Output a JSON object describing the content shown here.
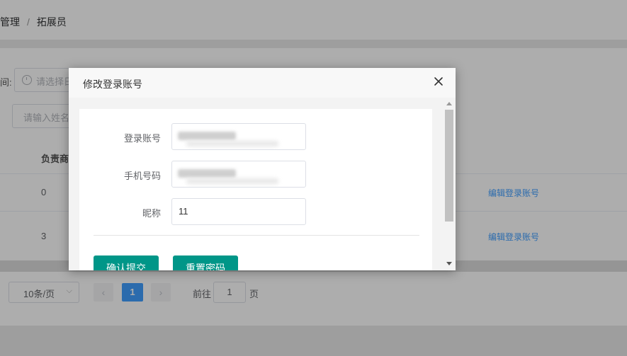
{
  "breadcrumb": {
    "parent": "管理",
    "separator": "/",
    "current": "拓展员"
  },
  "filters": {
    "time_label_tail": "间:",
    "date_placeholder": "请选择日",
    "name_placeholder": "请输入姓名"
  },
  "table": {
    "column_partial": "负责商",
    "rows": [
      {
        "value": "0",
        "action": "编辑登录账号"
      },
      {
        "value": "3",
        "action": "编辑登录账号"
      }
    ]
  },
  "pagination": {
    "page_size": "10条/页",
    "prev": "‹",
    "current_page": "1",
    "next": "›",
    "goto_label": "前往",
    "goto_value": "1",
    "goto_suffix": "页"
  },
  "dialog": {
    "title": "修改登录账号",
    "close_icon": "close-icon",
    "fields": [
      {
        "label": "登录账号",
        "value": "",
        "redacted": true
      },
      {
        "label": "手机号码",
        "value": "",
        "redacted": true
      },
      {
        "label": "昵称",
        "value": "11",
        "redacted": false
      }
    ],
    "buttons": {
      "submit": "确认提交",
      "reset": "重置密码"
    },
    "accent_color": "#009688"
  },
  "colors": {
    "link": "#409eff",
    "pager_active": "#409eff"
  }
}
